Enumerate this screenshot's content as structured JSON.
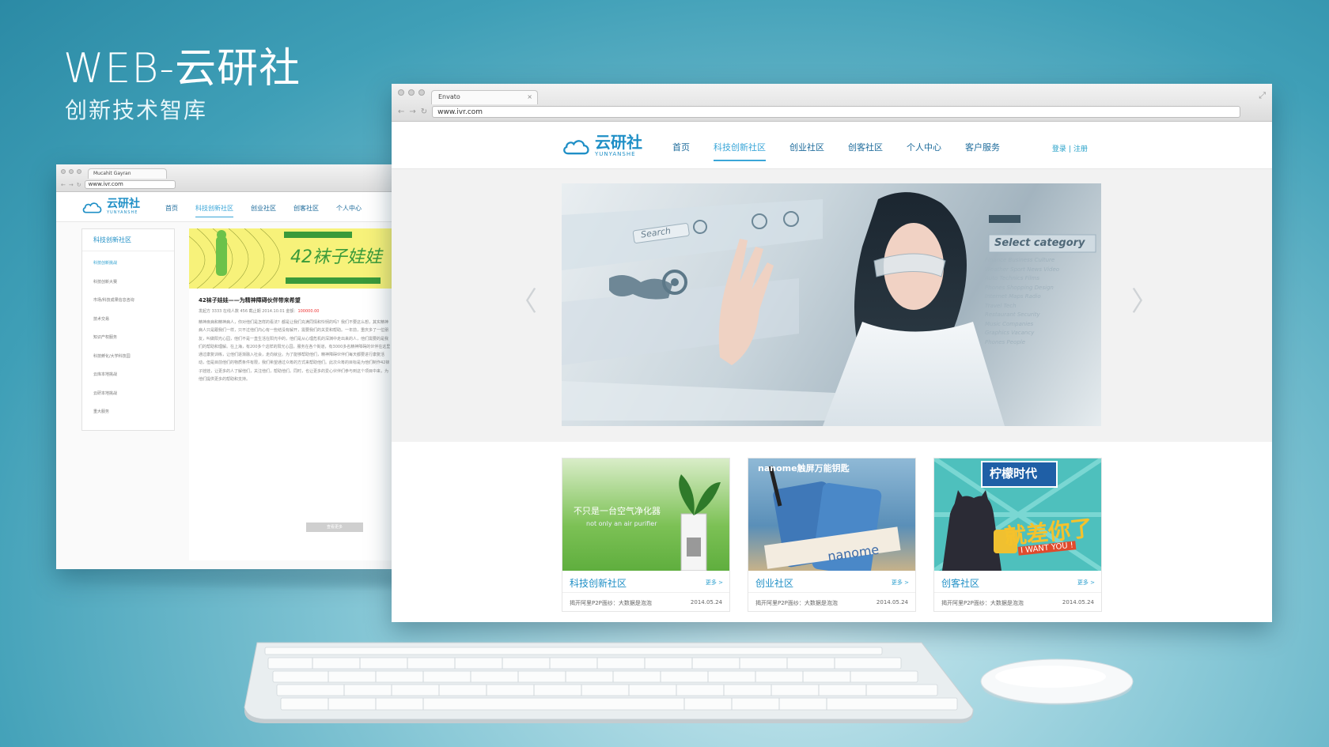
{
  "hero": {
    "title": "WEB-云研社",
    "subtitle": "创新技术智库"
  },
  "big_browser": {
    "tab_title": "Envato",
    "url": "www.ivr.com",
    "logo_cn": "云研社",
    "logo_en": "YUNYANSHE",
    "nav": [
      "首页",
      "科技创新社区",
      "创业社区",
      "创客社区",
      "个人中心",
      "客户服务"
    ],
    "login": "登录",
    "register": "注册",
    "banner": {
      "search_label": "Search",
      "category_title": "Select category",
      "category_items": [
        "Finance Business Culture",
        "Weather Sport News Video",
        "Auto Technics Films",
        "Phones Shopping Design",
        "Internet Maps Radio",
        "Travel Tech",
        "Restaurant Security",
        "Music Companies",
        "Graphics Vacancy",
        "Phones People"
      ]
    },
    "cards": [
      {
        "title": "科技创新社区",
        "more": "更多 >",
        "news": "揭开阿里P2P面纱：大数据是泡泡",
        "date": "2014.05.24",
        "img_text_1": "不只是一台空气净化器",
        "img_text_2": "not only an air purifier"
      },
      {
        "title": "创业社区",
        "more": "更多 >",
        "news": "揭开阿里P2P面纱：大数据是泡泡",
        "date": "2014.05.24",
        "img_text_1": "nanome触屏万能钥匙",
        "img_text_2": "nanome"
      },
      {
        "title": "创客社区",
        "more": "更多 >",
        "news": "揭开阿里P2P面纱：大数据是泡泡",
        "date": "2014.05.24",
        "img_text_1": "柠檬时代",
        "img_text_2": "就差你了",
        "img_text_3": "I WANT YOU !"
      }
    ]
  },
  "small_browser": {
    "tab_title": "Mucahit Gayran",
    "url": "www.ivr.com",
    "logo_cn": "云研社",
    "logo_en": "YUNYANSHE",
    "nav": [
      "首页",
      "科技创新社区",
      "创业社区",
      "创客社区",
      "个人中心"
    ],
    "sidebar_title": "科技创新社区",
    "sidebar_items": [
      "科技创新挑战",
      "科技创新大赛",
      "市场/科技成果信息咨询",
      "技术交易",
      "知识产权服务",
      "科技孵化/大学科技园",
      "云库本地挑战",
      "云研本地挑战",
      "重大服务"
    ],
    "article": {
      "img_text": "42袜子娃娃",
      "title": "42袜子娃娃——为精神障碍伙伴带来希望",
      "meta": "发起方 3333    在线人数 456    截止期 2014.10.01    金额：",
      "amount": "100000.00",
      "body": "精神疾病和精神病人，你对他们是怎样的看法？都是让我们充满同情和怜悯的吗？我们不要这么想，其实精神病人只是跟我们一样，只不过他们内心有一些结没有解开，需要我们的关爱和帮助。一年前，重庆多了一位朋友，叫做阳光心园，他们不是一直生活在阳光中的，他们是从心理危机的深渊中走出来的人，他们需要的是我们的帮助和理解。在上海，有200多个这样的阳光心园，服务在各个街道，有3000多名精神障碍的伙伴在这里通过康复训练，让他们逐渐融入社会，走向就业。为了能够帮助他们，精神障碍伙伴们每天都要进行康复活动，但是目前他们的物质条件有限，我们希望通过众筹的方式来帮助他们。此次众筹的目标是为他们制作42袜子娃娃，让更多的人了解他们，关注他们，帮助他们。同时，也让更多的爱心伙伴们参与到这个项目中来，为他们提供更多的帮助和支持。",
      "button": "查看更多"
    }
  }
}
